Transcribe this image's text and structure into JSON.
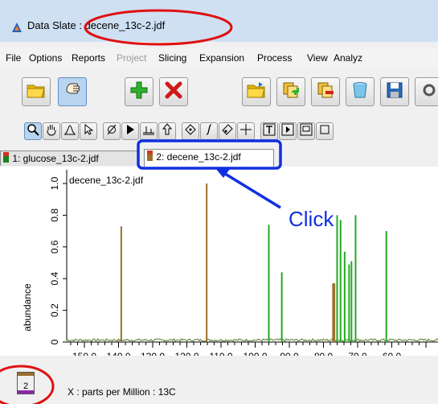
{
  "window": {
    "title": "Data Slate : decene_13c-2.jdf"
  },
  "menu": [
    {
      "label": "File",
      "disabled": false
    },
    {
      "label": "Options",
      "disabled": false
    },
    {
      "label": "Reports",
      "disabled": false
    },
    {
      "label": "Project",
      "disabled": true
    },
    {
      "label": "Slicing",
      "disabled": false
    },
    {
      "label": "Expansion",
      "disabled": false
    },
    {
      "label": "Process",
      "disabled": false
    },
    {
      "label": "View",
      "disabled": false
    },
    {
      "label": "Analyz",
      "disabled": false
    }
  ],
  "toolbar": {
    "large": [
      "open-folder-icon",
      "hand-pick-icon",
      "add-icon",
      "delete-icon",
      "open-folder-2-icon",
      "copy-add-icon",
      "copy-remove-icon",
      "trash-can-icon",
      "save-icon"
    ],
    "small": [
      "zoom-icon",
      "pan-icon",
      "peak-fit-icon",
      "select-arrow-icon",
      "phase-icon",
      "cursor-play-icon",
      "baseline-icon",
      "peak-pick-icon",
      "diamond-icon",
      "integral-icon",
      "eraser-icon",
      "crosshair-icon",
      "text-icon",
      "insert-icon",
      "frame-icon"
    ]
  },
  "tabs": [
    {
      "label": "1: glucose_13c-2.jdf",
      "active": false,
      "color_top": "#d03020",
      "color_bottom": "#208020"
    },
    {
      "label": "2: decene_13c-2.jdf",
      "active": true,
      "color_top": "#c04020",
      "color_bottom": "#9b6f2b"
    }
  ],
  "plot": {
    "title": "decene_13c-2.jdf",
    "ylabel": "abundance",
    "xlabel": "X : parts per Million : 13C",
    "yticks": [
      "0",
      "0.2",
      "0.4",
      "0.6",
      "0.8",
      "1.0"
    ],
    "xticks": [
      "150.0",
      "140.0",
      "130.0",
      "120.0",
      "110.0",
      "100.0",
      "90.0",
      "80.0",
      "70.0",
      "60.0"
    ],
    "colors": {
      "decene": "#9b6f2b",
      "glucose": "#22aa22",
      "noise": "#5a7a2a"
    }
  },
  "chart_data": {
    "type": "line",
    "title": "decene_13c-2.jdf",
    "xlabel": "X : parts per Million : 13C",
    "ylabel": "abundance",
    "xlim": [
      155,
      55
    ],
    "ylim": [
      0,
      1.05
    ],
    "series": [
      {
        "x": [
          139.2,
          114.2,
          77.2,
          77.0,
          76.8
        ],
        "y": [
          0.73,
          1.0,
          0.37,
          0.37,
          0.37
        ]
      },
      {
        "x": [
          96.0,
          92.2,
          76.0,
          75.0,
          73.8,
          72.5,
          71.8,
          70.6,
          61.6
        ],
        "y": [
          0.74,
          0.44,
          0.8,
          0.77,
          0.57,
          0.49,
          0.51,
          0.8,
          0.7
        ]
      }
    ]
  },
  "status": {
    "count": "2"
  },
  "annotations": {
    "click_label": "Click",
    "circle_color": "#e01010",
    "box_color": "#1030e0"
  }
}
